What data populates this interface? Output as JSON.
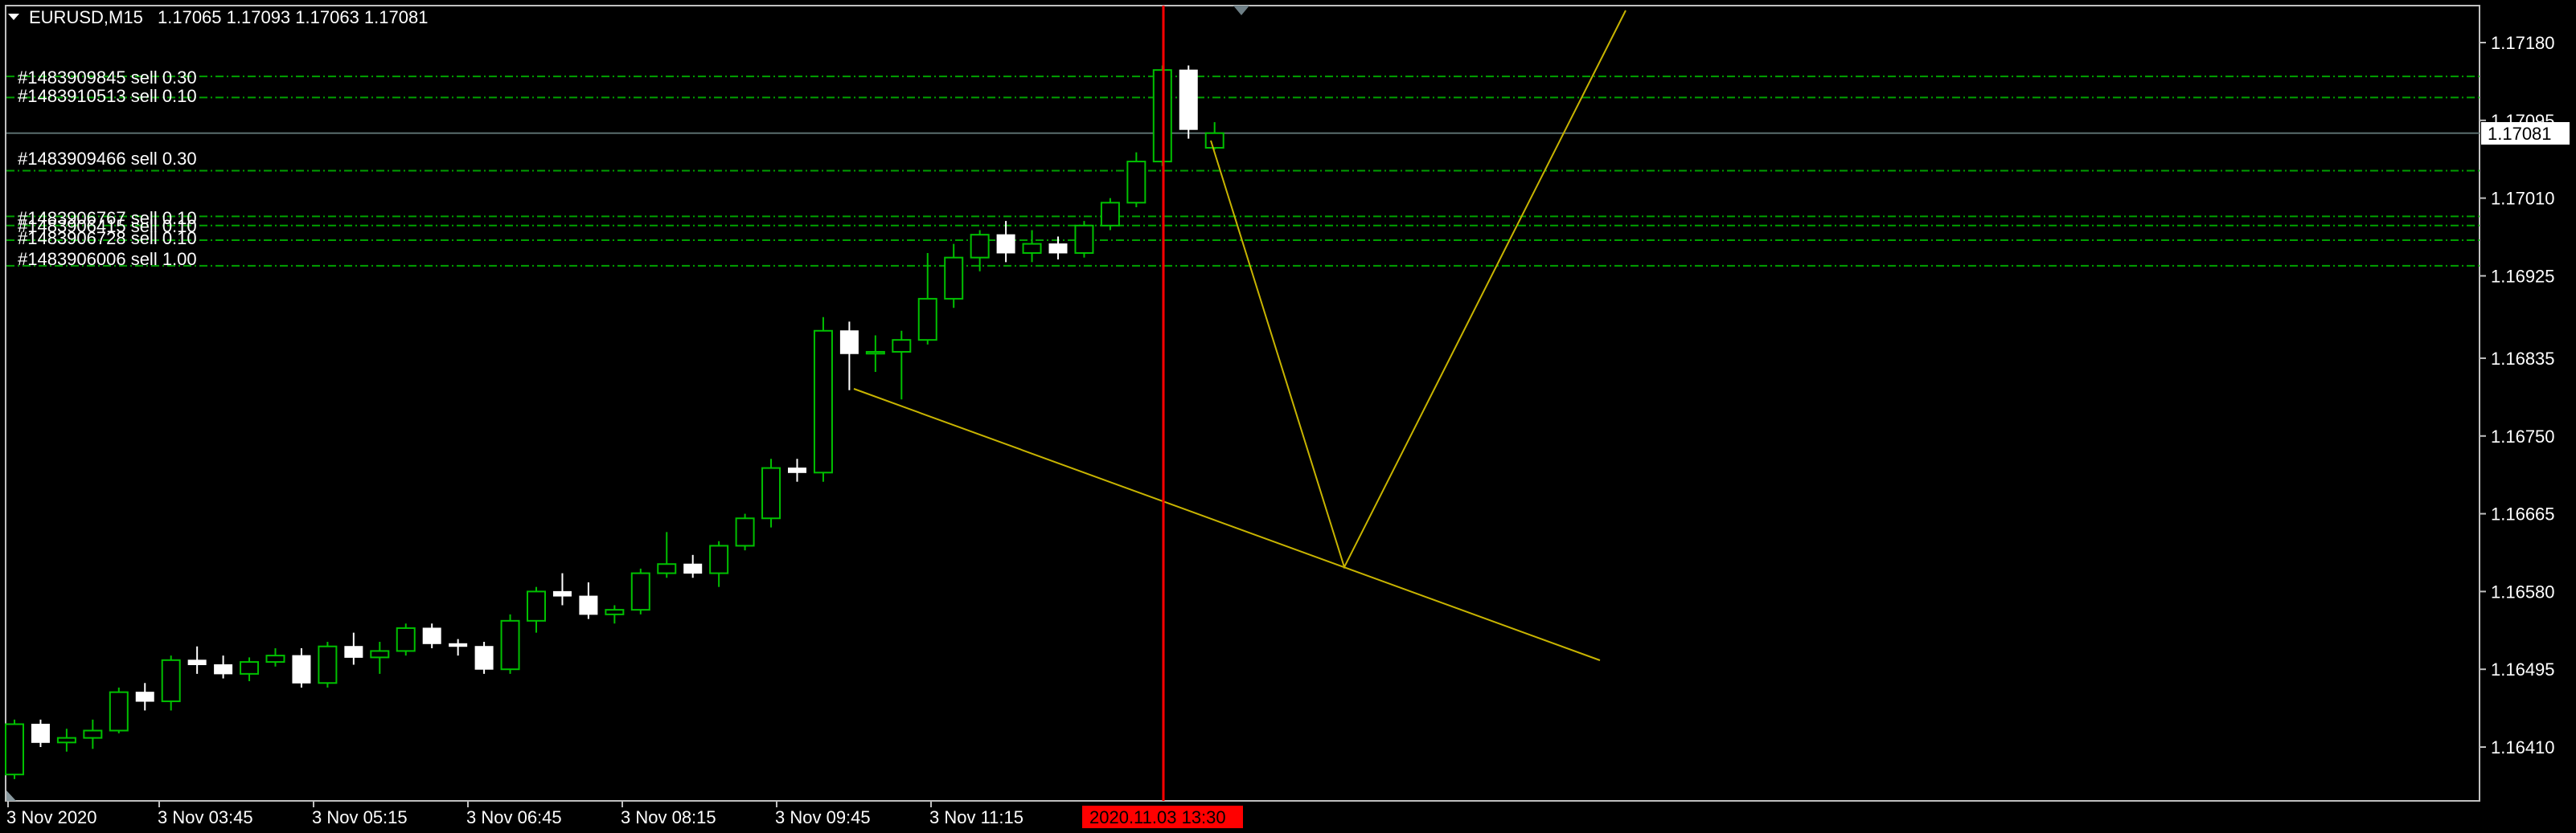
{
  "header": {
    "symbol": "EURUSD,M15",
    "ohlc": "1.17065 1.17093 1.17063 1.17081"
  },
  "colors": {
    "background": "#000000",
    "frame": "#c0c0c0",
    "bull": "#00c000",
    "bear": "#ffffff",
    "order_line": "#00a000",
    "bid_line": "#5a6e6e",
    "trendline": "#c8b400",
    "time_marker": "#ff0000"
  },
  "orders": [
    {
      "label": "#1483909845 sell 0.30",
      "price": 1.17143
    },
    {
      "label": "#1483910513 sell 0.10",
      "price": 1.1712
    },
    {
      "label": "#1483909466 sell 0.30",
      "price": 1.1704
    },
    {
      "label": "#1483906767 sell 0.10",
      "price": 1.1699
    },
    {
      "label": "#1483906415 sell 0.10",
      "price": 1.1698
    },
    {
      "label": "#1483906728 sell 0.10",
      "price": 1.16964
    },
    {
      "label": "#1483906006 sell 1.00",
      "price": 1.16936
    }
  ],
  "current_price_label": "1.17081",
  "time_marker_label": "2020.11.03 13:30",
  "chart_data": {
    "type": "candlestick",
    "symbol": "EURUSD",
    "timeframe": "M15",
    "y_ticks": [
      "1.17180",
      "1.17095",
      "1.17010",
      "1.16925",
      "1.16835",
      "1.16750",
      "1.16665",
      "1.16580",
      "1.16495",
      "1.16410"
    ],
    "x_ticks": [
      "3 Nov 2020",
      "3 Nov 03:45",
      "3 Nov 05:15",
      "3 Nov 06:45",
      "3 Nov 08:15",
      "3 Nov 09:45",
      "3 Nov 11:15"
    ],
    "ylim": [
      1.16335,
      1.17225
    ],
    "grid": false,
    "candles": [
      {
        "o": 1.1638,
        "h": 1.1644,
        "l": 1.16375,
        "c": 1.16435
      },
      {
        "o": 1.16435,
        "h": 1.1644,
        "l": 1.1641,
        "c": 1.16415
      },
      {
        "o": 1.16415,
        "h": 1.1643,
        "l": 1.16405,
        "c": 1.1642
      },
      {
        "o": 1.1642,
        "h": 1.1644,
        "l": 1.16408,
        "c": 1.16428
      },
      {
        "o": 1.16428,
        "h": 1.16475,
        "l": 1.16425,
        "c": 1.1647
      },
      {
        "o": 1.1647,
        "h": 1.1648,
        "l": 1.1645,
        "c": 1.1646
      },
      {
        "o": 1.1646,
        "h": 1.1651,
        "l": 1.1645,
        "c": 1.16505
      },
      {
        "o": 1.16505,
        "h": 1.1652,
        "l": 1.1649,
        "c": 1.165
      },
      {
        "o": 1.165,
        "h": 1.1651,
        "l": 1.16485,
        "c": 1.1649
      },
      {
        "o": 1.1649,
        "h": 1.16508,
        "l": 1.16482,
        "c": 1.16503
      },
      {
        "o": 1.16503,
        "h": 1.16518,
        "l": 1.16498,
        "c": 1.1651
      },
      {
        "o": 1.1651,
        "h": 1.16518,
        "l": 1.16475,
        "c": 1.1648
      },
      {
        "o": 1.1648,
        "h": 1.16525,
        "l": 1.16475,
        "c": 1.1652
      },
      {
        "o": 1.1652,
        "h": 1.16535,
        "l": 1.165,
        "c": 1.16508
      },
      {
        "o": 1.16508,
        "h": 1.16525,
        "l": 1.1649,
        "c": 1.16515
      },
      {
        "o": 1.16515,
        "h": 1.16545,
        "l": 1.1651,
        "c": 1.1654
      },
      {
        "o": 1.1654,
        "h": 1.16545,
        "l": 1.16518,
        "c": 1.16523
      },
      {
        "o": 1.16523,
        "h": 1.16528,
        "l": 1.1651,
        "c": 1.1652
      },
      {
        "o": 1.1652,
        "h": 1.16525,
        "l": 1.1649,
        "c": 1.16495
      },
      {
        "o": 1.16495,
        "h": 1.16555,
        "l": 1.1649,
        "c": 1.16548
      },
      {
        "o": 1.16548,
        "h": 1.16585,
        "l": 1.16535,
        "c": 1.1658
      },
      {
        "o": 1.1658,
        "h": 1.166,
        "l": 1.16565,
        "c": 1.16575
      },
      {
        "o": 1.16575,
        "h": 1.1659,
        "l": 1.1655,
        "c": 1.16555
      },
      {
        "o": 1.16555,
        "h": 1.16565,
        "l": 1.16545,
        "c": 1.1656
      },
      {
        "o": 1.1656,
        "h": 1.16605,
        "l": 1.16555,
        "c": 1.166
      },
      {
        "o": 1.166,
        "h": 1.16645,
        "l": 1.16595,
        "c": 1.1661
      },
      {
        "o": 1.1661,
        "h": 1.1662,
        "l": 1.16595,
        "c": 1.166
      },
      {
        "o": 1.166,
        "h": 1.16635,
        "l": 1.16585,
        "c": 1.1663
      },
      {
        "o": 1.1663,
        "h": 1.16665,
        "l": 1.16625,
        "c": 1.1666
      },
      {
        "o": 1.1666,
        "h": 1.16725,
        "l": 1.1665,
        "c": 1.16715
      },
      {
        "o": 1.16715,
        "h": 1.16725,
        "l": 1.167,
        "c": 1.1671
      },
      {
        "o": 1.1671,
        "h": 1.1688,
        "l": 1.167,
        "c": 1.16865
      },
      {
        "o": 1.16865,
        "h": 1.16875,
        "l": 1.168,
        "c": 1.1684
      },
      {
        "o": 1.1684,
        "h": 1.1686,
        "l": 1.1682,
        "c": 1.16842
      },
      {
        "o": 1.16842,
        "h": 1.16865,
        "l": 1.1679,
        "c": 1.16855
      },
      {
        "o": 1.16855,
        "h": 1.1695,
        "l": 1.1685,
        "c": 1.169
      },
      {
        "o": 1.169,
        "h": 1.1696,
        "l": 1.1689,
        "c": 1.16945
      },
      {
        "o": 1.16945,
        "h": 1.16975,
        "l": 1.1693,
        "c": 1.1697
      },
      {
        "o": 1.1697,
        "h": 1.16985,
        "l": 1.1694,
        "c": 1.1695
      },
      {
        "o": 1.1695,
        "h": 1.16975,
        "l": 1.1694,
        "c": 1.1696
      },
      {
        "o": 1.1696,
        "h": 1.16968,
        "l": 1.16943,
        "c": 1.1695
      },
      {
        "o": 1.1695,
        "h": 1.16985,
        "l": 1.16945,
        "c": 1.1698
      },
      {
        "o": 1.1698,
        "h": 1.1701,
        "l": 1.16975,
        "c": 1.17005
      },
      {
        "o": 1.17005,
        "h": 1.1706,
        "l": 1.17,
        "c": 1.1705
      },
      {
        "o": 1.1705,
        "h": 1.17155,
        "l": 1.17045,
        "c": 1.1715
      },
      {
        "o": 1.1715,
        "h": 1.17155,
        "l": 1.17075,
        "c": 1.17085
      },
      {
        "o": 1.17065,
        "h": 1.17093,
        "l": 1.17063,
        "c": 1.17081
      }
    ]
  }
}
